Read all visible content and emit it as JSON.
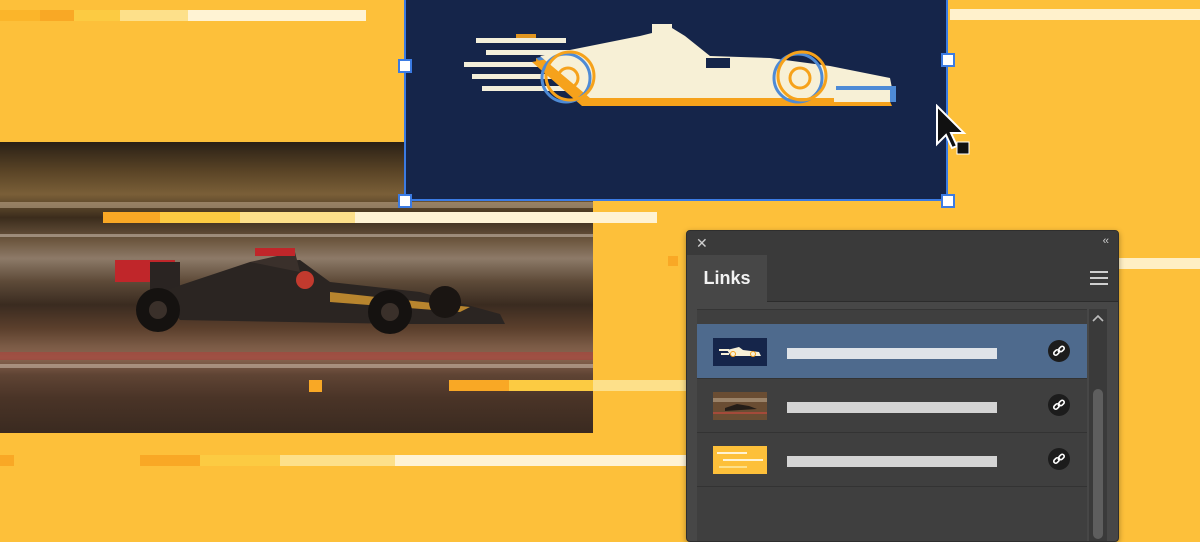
{
  "links_panel": {
    "tab_label": "Links",
    "close_icon": "close-icon",
    "collapse_icon": "double-chevron-left-icon",
    "menu_icon": "hamburger-menu-icon",
    "items": [
      {
        "thumbnail": "f1-illustration-thumbnail",
        "selected": true,
        "status_icon": "link-icon"
      },
      {
        "thumbnail": "race-photo-thumbnail",
        "selected": false,
        "status_icon": "link-icon"
      },
      {
        "thumbnail": "speed-stripes-thumbnail",
        "selected": false,
        "status_icon": "link-icon"
      }
    ]
  },
  "colors": {
    "background": "#FDC03A",
    "artboard": "#15254A",
    "selection": "#3B7BE3",
    "panel": "#474747",
    "selected_row": "#4E6A8D"
  },
  "cursor": "arrow-cursor-icon"
}
